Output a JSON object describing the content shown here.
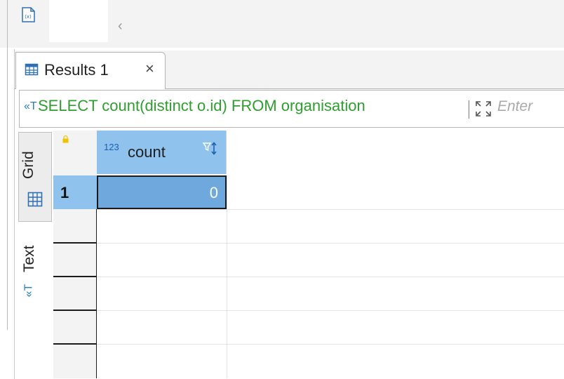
{
  "results_tab": {
    "label": "Results 1",
    "close": "×"
  },
  "query": {
    "text": "SELECT count(distinct o.id) FROM organisation",
    "filter_placeholder": "Enter"
  },
  "side_tabs": {
    "grid": "Grid",
    "text": "Text"
  },
  "grid": {
    "columns": [
      {
        "type_badge": "123",
        "name": "count"
      }
    ],
    "rows": [
      {
        "number": "1",
        "values": [
          "0"
        ]
      }
    ]
  },
  "colors": {
    "query_text": "#2e9e2e",
    "header_bg": "#8fc3ed",
    "selected_cell": "#6fa8dc"
  },
  "icons": [
    "variable-icon",
    "scroll-left-icon",
    "table-icon",
    "close-icon",
    "text-format-icon",
    "expand-icon",
    "lock-icon",
    "number-type-icon",
    "filter-sort-icon"
  ]
}
